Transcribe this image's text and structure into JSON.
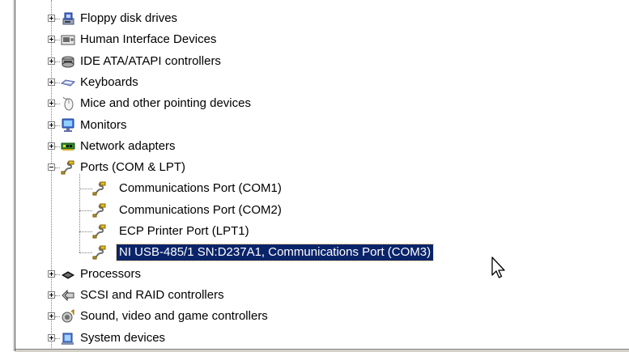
{
  "tree": {
    "categories": [
      {
        "label": "Floppy disk drives",
        "icon": "floppy-drive-icon",
        "expanded": false
      },
      {
        "label": "Human Interface Devices",
        "icon": "hid-icon",
        "expanded": false
      },
      {
        "label": "IDE ATA/ATAPI controllers",
        "icon": "ide-controller-icon",
        "expanded": false
      },
      {
        "label": "Keyboards",
        "icon": "keyboard-icon",
        "expanded": false
      },
      {
        "label": "Mice and other pointing devices",
        "icon": "mouse-icon",
        "expanded": false
      },
      {
        "label": "Monitors",
        "icon": "monitor-icon",
        "expanded": false
      },
      {
        "label": "Network adapters",
        "icon": "network-adapter-icon",
        "expanded": false
      },
      {
        "label": "Ports (COM & LPT)",
        "icon": "port-icon",
        "expanded": true,
        "children": [
          {
            "label": "Communications Port (COM1)",
            "icon": "port-icon"
          },
          {
            "label": "Communications Port (COM2)",
            "icon": "port-icon"
          },
          {
            "label": "ECP Printer Port (LPT1)",
            "icon": "port-icon"
          },
          {
            "label": "NI USB-485/1 SN:D237A1, Communications Port (COM3)",
            "icon": "port-icon",
            "selected": true
          }
        ]
      },
      {
        "label": "Processors",
        "icon": "processor-icon",
        "expanded": false
      },
      {
        "label": "SCSI and RAID controllers",
        "icon": "scsi-controller-icon",
        "expanded": false
      },
      {
        "label": "Sound, video and game controllers",
        "icon": "sound-icon",
        "expanded": false
      },
      {
        "label": "System devices",
        "icon": "system-devices-icon",
        "expanded": false
      }
    ]
  },
  "colors": {
    "selection_bg": "#0a246a",
    "selection_fg": "#ffffff",
    "tree_line": "#808080"
  }
}
